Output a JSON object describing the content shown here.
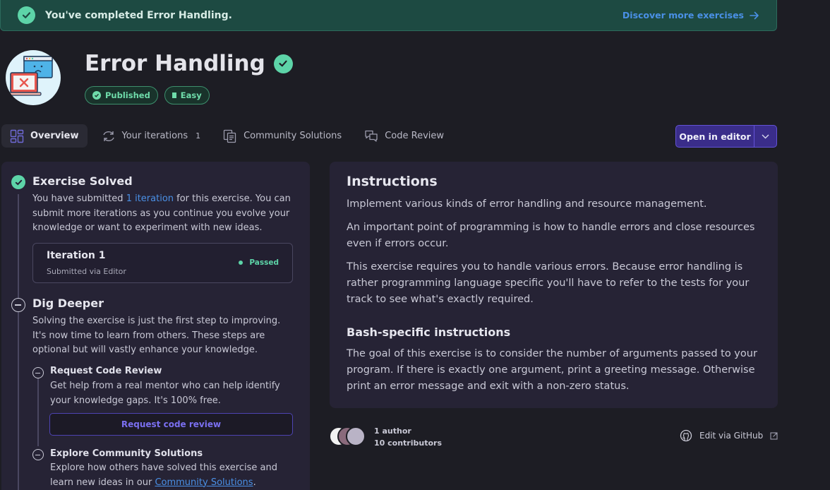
{
  "banner": {
    "message": "You've completed Error Handling.",
    "discover_label": "Discover more exercises"
  },
  "header": {
    "title": "Error Handling",
    "pills": [
      {
        "label": "Published"
      },
      {
        "label": "Easy"
      }
    ]
  },
  "tabs": [
    {
      "label": "Overview"
    },
    {
      "label": "Your iterations",
      "count": "1"
    },
    {
      "label": "Community Solutions"
    },
    {
      "label": "Code Review"
    }
  ],
  "open_editor": {
    "label": "Open in editor"
  },
  "left": {
    "solved": {
      "title": "Exercise Solved",
      "text_before": "You have submitted ",
      "link": "1 iteration",
      "text_after": " for this exercise. You can submit more iterations as you continue you evolve your knowledge or want to experiment with new ideas."
    },
    "iteration": {
      "title": "Iteration 1",
      "subtitle": "Submitted via Editor",
      "status": "Passed"
    },
    "dig": {
      "title": "Dig Deeper",
      "text": "Solving the exercise is just the first step to improving. It's now time to learn from others. These steps are optional but will vastly enhance your knowledge."
    },
    "review": {
      "title": "Request Code Review",
      "text": "Get help from a real mentor who can help identify your knowledge gaps. It's 100% free.",
      "button": "Request code review"
    },
    "explore": {
      "title": "Explore Community Solutions",
      "text_before": "Explore how others have solved this exercise and learn new ideas in our ",
      "link": "Community Solutions",
      "text_after": "."
    }
  },
  "instructions": {
    "title": "Instructions",
    "p1": "Implement various kinds of error handling and resource management.",
    "p2": "An important point of programming is how to handle errors and close resources even if errors occur.",
    "p3": "This exercise requires you to handle various errors. Because error handling is rather programming language specific you'll have to refer to the tests for your track to see what's exactly required.",
    "bash_title": "Bash-specific instructions",
    "p4": "The goal of this exercise is to consider the number of arguments passed to your program. If there is exactly one argument, print a greeting message. Otherwise print an error message and exit with a non-zero status."
  },
  "footer": {
    "authors": "1 author",
    "contributors": "10 contributors",
    "edit": "Edit via GitHub"
  },
  "colors": {
    "accent": "#5dd4a8",
    "link": "#4a90e6",
    "primary": "#3a2d8a"
  }
}
